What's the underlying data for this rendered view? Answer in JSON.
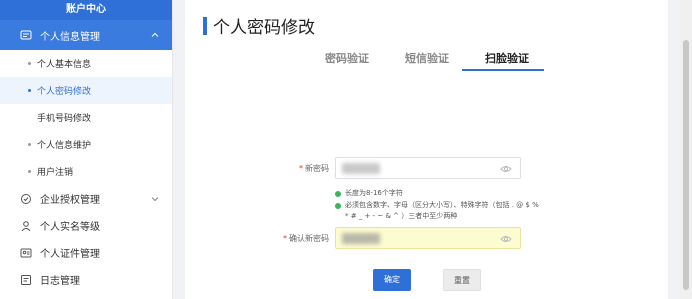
{
  "sidebar": {
    "header": "账户中心",
    "groups": [
      {
        "label": "个人信息管理",
        "icon": "user-card-icon",
        "expanded": true
      },
      {
        "label": "企业授权管理",
        "icon": "shield-check-icon"
      },
      {
        "label": "个人实名等级",
        "icon": "person-icon"
      },
      {
        "label": "个人证件管理",
        "icon": "id-card-icon"
      },
      {
        "label": "日志管理",
        "icon": "log-icon"
      }
    ],
    "subitems": [
      {
        "label": "个人基本信息"
      },
      {
        "label": "个人密码修改",
        "active": true
      },
      {
        "label": "手机号码修改"
      },
      {
        "label": "个人信息维护"
      },
      {
        "label": "用户注销"
      }
    ]
  },
  "main": {
    "title": "个人密码修改",
    "tabs": [
      {
        "label": "密码验证"
      },
      {
        "label": "短信验证"
      },
      {
        "label": "扫脸验证",
        "active": true
      }
    ],
    "form": {
      "new_password_label": "新密码",
      "confirm_password_label": "确认新密码",
      "required_mark": "*",
      "rules": [
        "长度为8-16个字符",
        "必须包含数字、字母（区分大小写）、特殊字符（包括 . @ $ %",
        "* # _ + - ~ & ^ ）三者中至少两种"
      ],
      "confirm_prefix": "*"
    },
    "buttons": {
      "confirm": "确定",
      "reset": "重置"
    }
  },
  "colors": {
    "primary": "#2f6fd8",
    "success": "#3cb55c",
    "autofill": "#fdfbd0"
  }
}
